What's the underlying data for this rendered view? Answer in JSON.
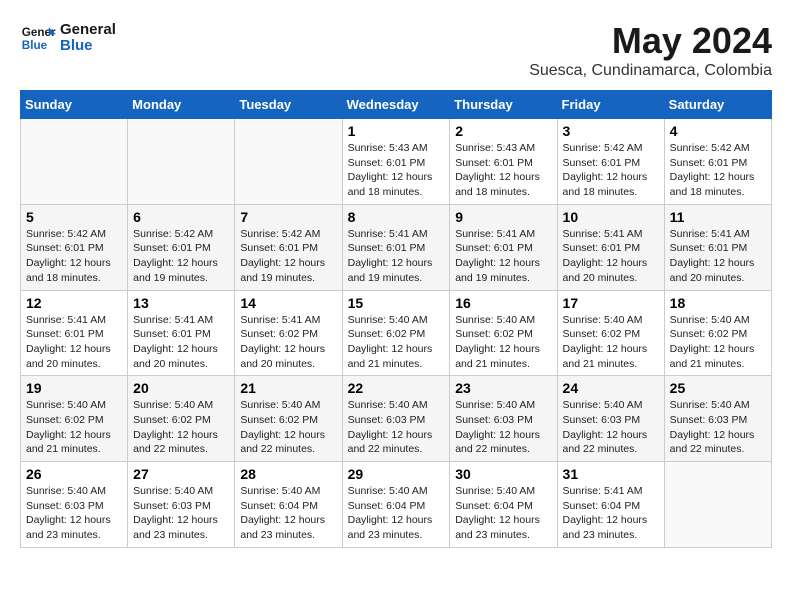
{
  "logo": {
    "line1": "General",
    "line2": "Blue"
  },
  "title": "May 2024",
  "subtitle": "Suesca, Cundinamarca, Colombia",
  "days_header": [
    "Sunday",
    "Monday",
    "Tuesday",
    "Wednesday",
    "Thursday",
    "Friday",
    "Saturday"
  ],
  "weeks": [
    [
      {
        "day": "",
        "info": ""
      },
      {
        "day": "",
        "info": ""
      },
      {
        "day": "",
        "info": ""
      },
      {
        "day": "1",
        "info": "Sunrise: 5:43 AM\nSunset: 6:01 PM\nDaylight: 12 hours\nand 18 minutes."
      },
      {
        "day": "2",
        "info": "Sunrise: 5:43 AM\nSunset: 6:01 PM\nDaylight: 12 hours\nand 18 minutes."
      },
      {
        "day": "3",
        "info": "Sunrise: 5:42 AM\nSunset: 6:01 PM\nDaylight: 12 hours\nand 18 minutes."
      },
      {
        "day": "4",
        "info": "Sunrise: 5:42 AM\nSunset: 6:01 PM\nDaylight: 12 hours\nand 18 minutes."
      }
    ],
    [
      {
        "day": "5",
        "info": "Sunrise: 5:42 AM\nSunset: 6:01 PM\nDaylight: 12 hours\nand 18 minutes."
      },
      {
        "day": "6",
        "info": "Sunrise: 5:42 AM\nSunset: 6:01 PM\nDaylight: 12 hours\nand 19 minutes."
      },
      {
        "day": "7",
        "info": "Sunrise: 5:42 AM\nSunset: 6:01 PM\nDaylight: 12 hours\nand 19 minutes."
      },
      {
        "day": "8",
        "info": "Sunrise: 5:41 AM\nSunset: 6:01 PM\nDaylight: 12 hours\nand 19 minutes."
      },
      {
        "day": "9",
        "info": "Sunrise: 5:41 AM\nSunset: 6:01 PM\nDaylight: 12 hours\nand 19 minutes."
      },
      {
        "day": "10",
        "info": "Sunrise: 5:41 AM\nSunset: 6:01 PM\nDaylight: 12 hours\nand 20 minutes."
      },
      {
        "day": "11",
        "info": "Sunrise: 5:41 AM\nSunset: 6:01 PM\nDaylight: 12 hours\nand 20 minutes."
      }
    ],
    [
      {
        "day": "12",
        "info": "Sunrise: 5:41 AM\nSunset: 6:01 PM\nDaylight: 12 hours\nand 20 minutes."
      },
      {
        "day": "13",
        "info": "Sunrise: 5:41 AM\nSunset: 6:01 PM\nDaylight: 12 hours\nand 20 minutes."
      },
      {
        "day": "14",
        "info": "Sunrise: 5:41 AM\nSunset: 6:02 PM\nDaylight: 12 hours\nand 20 minutes."
      },
      {
        "day": "15",
        "info": "Sunrise: 5:40 AM\nSunset: 6:02 PM\nDaylight: 12 hours\nand 21 minutes."
      },
      {
        "day": "16",
        "info": "Sunrise: 5:40 AM\nSunset: 6:02 PM\nDaylight: 12 hours\nand 21 minutes."
      },
      {
        "day": "17",
        "info": "Sunrise: 5:40 AM\nSunset: 6:02 PM\nDaylight: 12 hours\nand 21 minutes."
      },
      {
        "day": "18",
        "info": "Sunrise: 5:40 AM\nSunset: 6:02 PM\nDaylight: 12 hours\nand 21 minutes."
      }
    ],
    [
      {
        "day": "19",
        "info": "Sunrise: 5:40 AM\nSunset: 6:02 PM\nDaylight: 12 hours\nand 21 minutes."
      },
      {
        "day": "20",
        "info": "Sunrise: 5:40 AM\nSunset: 6:02 PM\nDaylight: 12 hours\nand 22 minutes."
      },
      {
        "day": "21",
        "info": "Sunrise: 5:40 AM\nSunset: 6:02 PM\nDaylight: 12 hours\nand 22 minutes."
      },
      {
        "day": "22",
        "info": "Sunrise: 5:40 AM\nSunset: 6:03 PM\nDaylight: 12 hours\nand 22 minutes."
      },
      {
        "day": "23",
        "info": "Sunrise: 5:40 AM\nSunset: 6:03 PM\nDaylight: 12 hours\nand 22 minutes."
      },
      {
        "day": "24",
        "info": "Sunrise: 5:40 AM\nSunset: 6:03 PM\nDaylight: 12 hours\nand 22 minutes."
      },
      {
        "day": "25",
        "info": "Sunrise: 5:40 AM\nSunset: 6:03 PM\nDaylight: 12 hours\nand 22 minutes."
      }
    ],
    [
      {
        "day": "26",
        "info": "Sunrise: 5:40 AM\nSunset: 6:03 PM\nDaylight: 12 hours\nand 23 minutes."
      },
      {
        "day": "27",
        "info": "Sunrise: 5:40 AM\nSunset: 6:03 PM\nDaylight: 12 hours\nand 23 minutes."
      },
      {
        "day": "28",
        "info": "Sunrise: 5:40 AM\nSunset: 6:04 PM\nDaylight: 12 hours\nand 23 minutes."
      },
      {
        "day": "29",
        "info": "Sunrise: 5:40 AM\nSunset: 6:04 PM\nDaylight: 12 hours\nand 23 minutes."
      },
      {
        "day": "30",
        "info": "Sunrise: 5:40 AM\nSunset: 6:04 PM\nDaylight: 12 hours\nand 23 minutes."
      },
      {
        "day": "31",
        "info": "Sunrise: 5:41 AM\nSunset: 6:04 PM\nDaylight: 12 hours\nand 23 minutes."
      },
      {
        "day": "",
        "info": ""
      }
    ]
  ]
}
